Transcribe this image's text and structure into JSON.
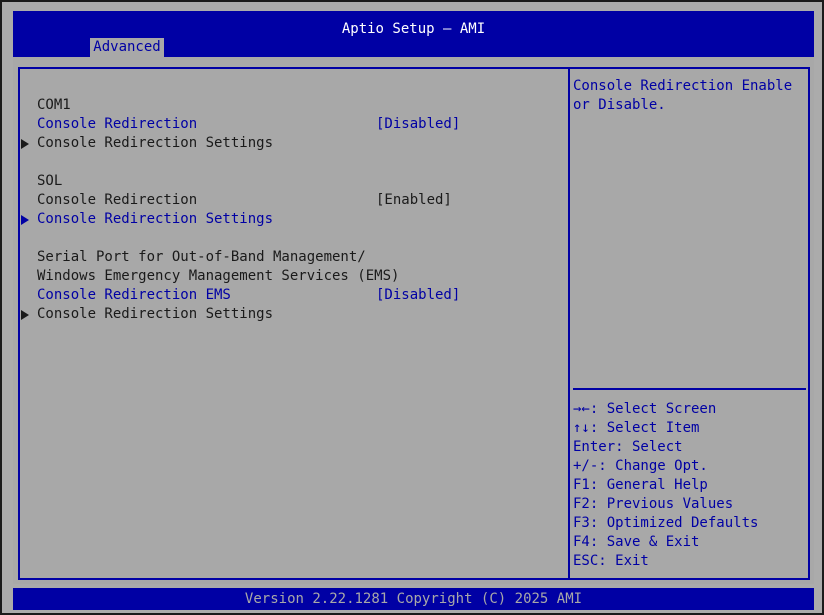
{
  "header": {
    "title": "Aptio Setup – AMI",
    "active_tab": "Advanced"
  },
  "settings": {
    "com1_heading": "COM1",
    "com1_redirection_label": "Console Redirection",
    "com1_redirection_value": "[Disabled]",
    "com1_settings_label": "Console Redirection Settings",
    "sol_heading": "SOL",
    "sol_redirection_label": "Console Redirection",
    "sol_redirection_value": "[Enabled]",
    "sol_settings_label": "Console Redirection Settings",
    "ems_heading_line1": "Serial Port for Out-of-Band Management/",
    "ems_heading_line2": "Windows Emergency Management Services (EMS)",
    "ems_redirection_label": "Console Redirection EMS",
    "ems_redirection_value": "[Disabled]",
    "ems_settings_label": "Console Redirection Settings"
  },
  "help": {
    "description": "Console Redirection Enable\nor Disable."
  },
  "keys": [
    "→←: Select Screen",
    "↑↓: Select Item",
    "Enter: Select",
    "+/-: Change Opt.",
    "F1: General Help",
    "F2: Previous Values",
    "F3: Optimized Defaults",
    "F4: Save & Exit",
    "ESC: Exit"
  ],
  "footer": {
    "version": "Version 2.22.1281 Copyright (C) 2025 AMI"
  },
  "colors": {
    "header_bg": "#0000a4",
    "panel_bg": "#a8a8a8",
    "highlight": "#0000a4",
    "text": "#1a1a1a"
  }
}
